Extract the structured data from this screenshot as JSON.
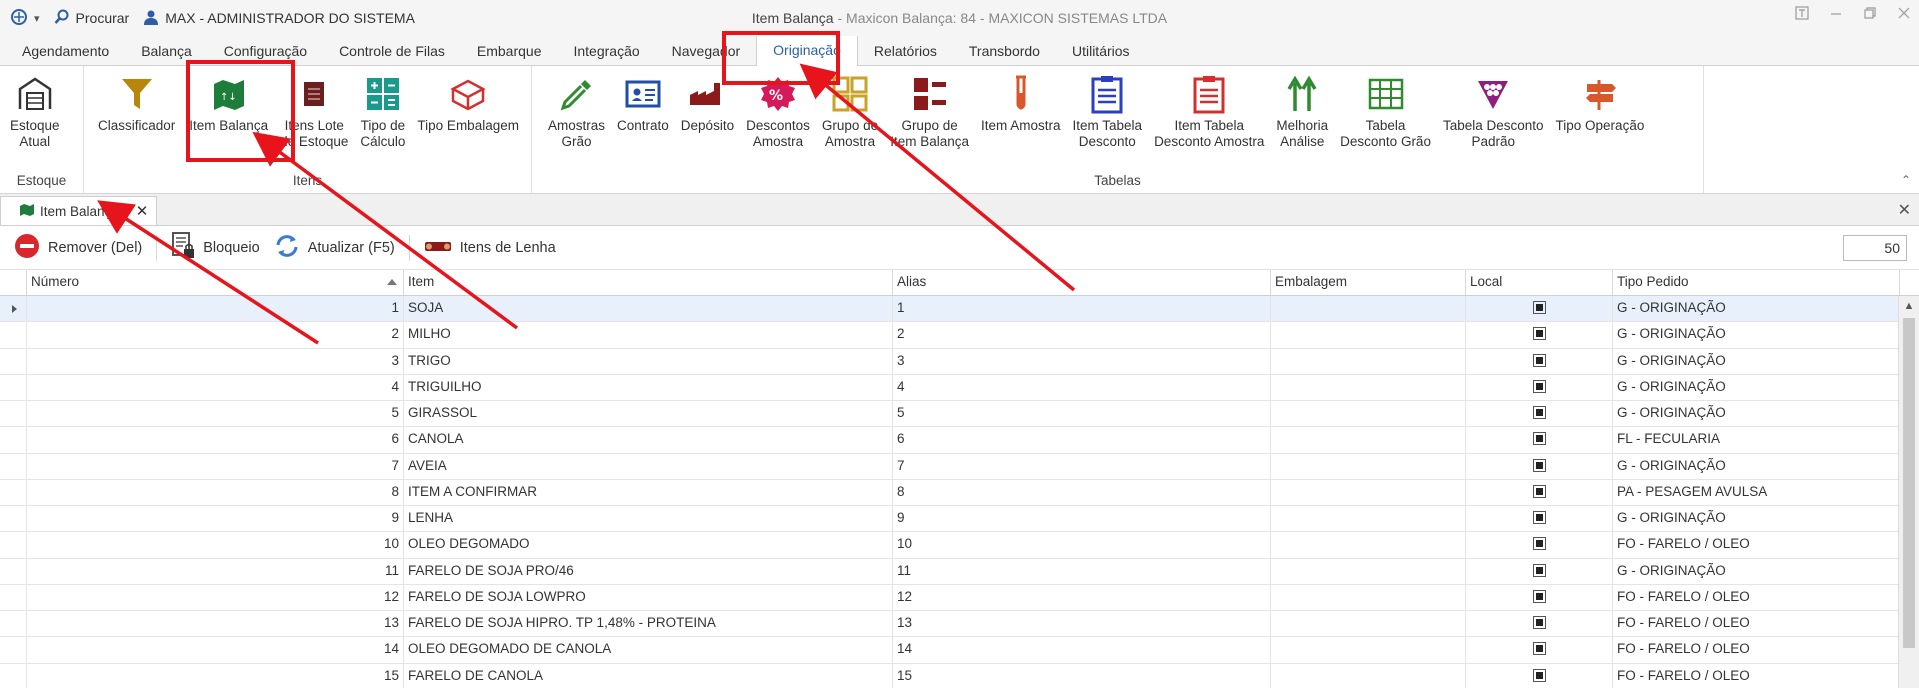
{
  "titlebar": {
    "menu_arrow": "▾",
    "search_label": "Procurar",
    "user_label": "MAX - ADMINISTRADOR DO SISTEMA",
    "title_main": "Item Balança",
    "title_suffix": " - Maxicon Balança: 84 - MAXICON SISTEMAS LTDA"
  },
  "menu": [
    {
      "label": "Agendamento",
      "active": false
    },
    {
      "label": "Balança",
      "active": false
    },
    {
      "label": "Configuração",
      "active": false
    },
    {
      "label": "Controle de Filas",
      "active": false
    },
    {
      "label": "Embarque",
      "active": false
    },
    {
      "label": "Integração",
      "active": false
    },
    {
      "label": "Navegador",
      "active": false
    },
    {
      "label": "Originação",
      "active": true
    },
    {
      "label": "Relatórios",
      "active": false
    },
    {
      "label": "Transbordo",
      "active": false
    },
    {
      "label": "Utilitários",
      "active": false
    }
  ],
  "ribbon": {
    "estoque": {
      "group_label": "Estoque",
      "estoque_atual": "Estoque\nAtual"
    },
    "itens": {
      "group_label": "Itens",
      "classificador": "Classificador",
      "item_balanca": "Item Balança",
      "itens_lote": "Itens Lote\nde Estoque",
      "tipo_calculo": "Tipo de\nCálculo",
      "tipo_embalagem": "Tipo Embalagem"
    },
    "tabelas": {
      "group_label": "Tabelas",
      "amostras_grao": "Amostras\nGrão",
      "contrato": "Contrato",
      "deposito": "Depósito",
      "descontos_amostra": "Descontos\nAmostra",
      "grupo_amostra": "Grupo de\nAmostra",
      "grupo_item_balanca": "Grupo de\nItem Balança",
      "item_amostra": "Item Amostra",
      "item_tabela_desconto": "Item Tabela\nDesconto",
      "item_tabela_desconto_amostra": "Item Tabela\nDesconto Amostra",
      "melhoria_analise": "Melhoria\nAnálise",
      "tabela_desconto_grao": "Tabela\nDesconto Grão",
      "tabela_desconto_padrao": "Tabela Desconto\nPadrão",
      "tipo_operacao": "Tipo Operação"
    },
    "collapse_glyph": "⌃"
  },
  "doc_tab": {
    "label": "Item Balança",
    "close_glyph": "✕"
  },
  "doc_tabs_close": "✕",
  "toolbar": {
    "remover": "Remover (Del)",
    "bloqueio": "Bloqueio",
    "atualizar": "Atualizar (F5)",
    "itens_lenha": "Itens de Lenha",
    "page_size": "50"
  },
  "grid": {
    "columns": [
      "Número",
      "Item",
      "Alias",
      "Embalagem",
      "Local",
      "Tipo Pedido"
    ],
    "rows": [
      {
        "numero": "1",
        "item": "SOJA",
        "alias": "1",
        "embalagem": "",
        "tipo": "G - ORIGINAÇÃO"
      },
      {
        "numero": "2",
        "item": "MILHO",
        "alias": "2",
        "embalagem": "",
        "tipo": "G - ORIGINAÇÃO"
      },
      {
        "numero": "3",
        "item": "TRIGO",
        "alias": "3",
        "embalagem": "",
        "tipo": "G - ORIGINAÇÃO"
      },
      {
        "numero": "4",
        "item": "TRIGUILHO",
        "alias": "4",
        "embalagem": "",
        "tipo": "G - ORIGINAÇÃO"
      },
      {
        "numero": "5",
        "item": "GIRASSOL",
        "alias": "5",
        "embalagem": "",
        "tipo": "G - ORIGINAÇÃO"
      },
      {
        "numero": "6",
        "item": "CANOLA",
        "alias": "6",
        "embalagem": "",
        "tipo": "FL - FECULARIA"
      },
      {
        "numero": "7",
        "item": "AVEIA",
        "alias": "7",
        "embalagem": "",
        "tipo": "G - ORIGINAÇÃO"
      },
      {
        "numero": "8",
        "item": "ITEM A CONFIRMAR",
        "alias": "8",
        "embalagem": "",
        "tipo": "PA - PESAGEM AVULSA"
      },
      {
        "numero": "9",
        "item": "LENHA",
        "alias": "9",
        "embalagem": "",
        "tipo": "G - ORIGINAÇÃO"
      },
      {
        "numero": "10",
        "item": "OLEO DEGOMADO",
        "alias": "10",
        "embalagem": "",
        "tipo": "FO - FARELO / OLEO"
      },
      {
        "numero": "11",
        "item": "FARELO DE SOJA PRO/46",
        "alias": "11",
        "embalagem": "",
        "tipo": "G - ORIGINAÇÃO"
      },
      {
        "numero": "12",
        "item": "FARELO DE SOJA LOWPRO",
        "alias": "12",
        "embalagem": "",
        "tipo": "FO - FARELO / OLEO"
      },
      {
        "numero": "13",
        "item": "FARELO DE SOJA HIPRO. TP 1,48% - PROTEINA",
        "alias": "13",
        "embalagem": "",
        "tipo": "FO - FARELO / OLEO"
      },
      {
        "numero": "14",
        "item": "OLEO DEGOMADO DE CANOLA",
        "alias": "14",
        "embalagem": "",
        "tipo": "FO - FARELO / OLEO"
      },
      {
        "numero": "15",
        "item": "FARELO DE CANOLA",
        "alias": "15",
        "embalagem": "",
        "tipo": "FO - FARELO / OLEO"
      }
    ]
  },
  "colors": {
    "accent": "#2b5ea8",
    "annotation_red": "#e8141c",
    "selected_row": "#e8f1fb"
  }
}
